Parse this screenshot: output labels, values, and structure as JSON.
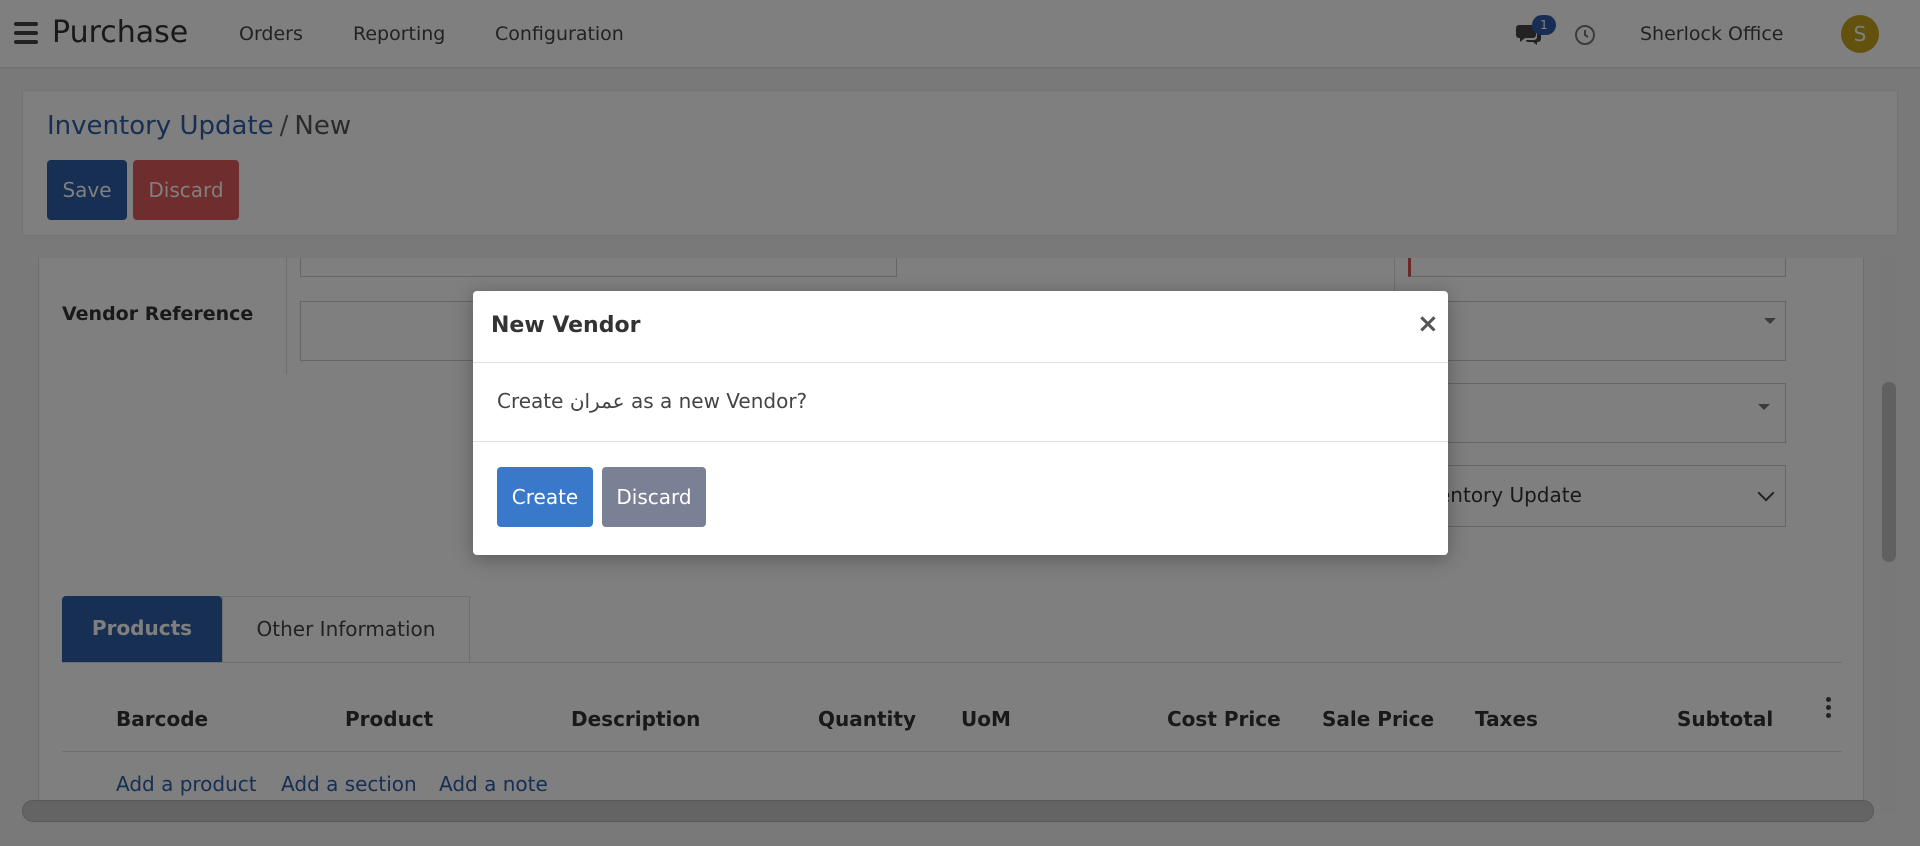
{
  "navbar": {
    "app_title": "Purchase",
    "menu": [
      "Orders",
      "Reporting",
      "Configuration"
    ],
    "notification_count": "1",
    "user_name": "Sherlock Office",
    "avatar_initial": "S"
  },
  "control_panel": {
    "breadcrumb_parent": "Inventory Update",
    "breadcrumb_separator": "/",
    "breadcrumb_current": "New",
    "save_label": "Save",
    "discard_label": "Discard"
  },
  "form": {
    "vendor_reference_label": "Vendor Reference",
    "operation_type_value": "entory Update"
  },
  "tabs": [
    "Products",
    "Other Information"
  ],
  "table": {
    "columns": [
      "Barcode",
      "Product",
      "Description",
      "Quantity",
      "UoM",
      "Cost Price",
      "Sale Price",
      "Taxes",
      "Subtotal"
    ],
    "add_links": [
      "Add a product",
      "Add a section",
      "Add a note"
    ]
  },
  "modal": {
    "title": "New Vendor",
    "close_symbol": "×",
    "message": "Create عمران as a new Vendor?",
    "create_label": "Create",
    "discard_label": "Discard"
  },
  "colors": {
    "primary": "#2c5fa6",
    "danger": "#e05b5b",
    "modal_primary": "#3a78c9",
    "modal_secondary": "#7a8194",
    "avatar": "#c6a31c"
  }
}
